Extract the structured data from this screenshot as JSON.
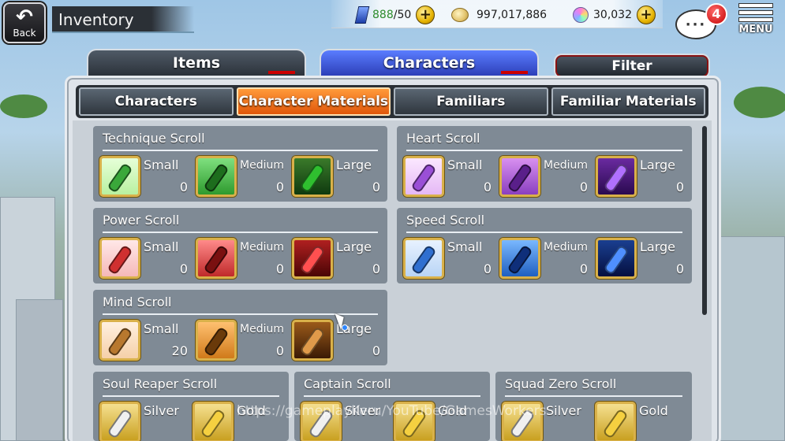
{
  "header": {
    "back_label": "Back",
    "title": "Inventory",
    "stamina": {
      "current": "888",
      "max": "/50"
    },
    "coins": "997,017,886",
    "gems": "30,032",
    "notification_count": "4",
    "chat_dots": "···",
    "menu_label": "MENU"
  },
  "main_tabs": {
    "items": "Items",
    "characters": "Characters",
    "filter": "Filter"
  },
  "sub_tabs": [
    "Characters",
    "Character Materials",
    "Familiars",
    "Familiar Materials"
  ],
  "cards": [
    {
      "title": "Technique Scroll",
      "items": [
        {
          "name": "Small",
          "count": "0"
        },
        {
          "name": "Medium",
          "count": "0"
        },
        {
          "name": "Large",
          "count": "0"
        }
      ]
    },
    {
      "title": "Heart Scroll",
      "items": [
        {
          "name": "Small",
          "count": "0"
        },
        {
          "name": "Medium",
          "count": "0"
        },
        {
          "name": "Large",
          "count": "0"
        }
      ]
    },
    {
      "title": "Power Scroll",
      "items": [
        {
          "name": "Small",
          "count": "0"
        },
        {
          "name": "Medium",
          "count": "0"
        },
        {
          "name": "Large",
          "count": "0"
        }
      ]
    },
    {
      "title": "Speed Scroll",
      "items": [
        {
          "name": "Small",
          "count": "0"
        },
        {
          "name": "Medium",
          "count": "0"
        },
        {
          "name": "Large",
          "count": "0"
        }
      ]
    },
    {
      "title": "Mind Scroll",
      "items": [
        {
          "name": "Small",
          "count": "20"
        },
        {
          "name": "Medium",
          "count": "0"
        },
        {
          "name": "Large",
          "count": "0"
        }
      ]
    },
    {
      "title": "Soul Reaper Scroll",
      "items": [
        {
          "name": "Silver"
        },
        {
          "name": "Gold"
        }
      ]
    },
    {
      "title": "Captain Scroll",
      "items": [
        {
          "name": "Silver"
        },
        {
          "name": "Gold"
        }
      ]
    },
    {
      "title": "Squad Zero Scroll",
      "items": [
        {
          "name": "Silver"
        },
        {
          "name": "Gold"
        }
      ]
    }
  ],
  "watermark": "https://gameplayKeru/YouTube/GamesWorkers",
  "colors": {
    "technique": "#3aa83a",
    "heart": "#9a4fd6",
    "power": "#d03030",
    "speed": "#2f6fd0",
    "mind": "#b8782e",
    "silver_gold": "#e0c040",
    "active_tab": "#f07a20"
  }
}
